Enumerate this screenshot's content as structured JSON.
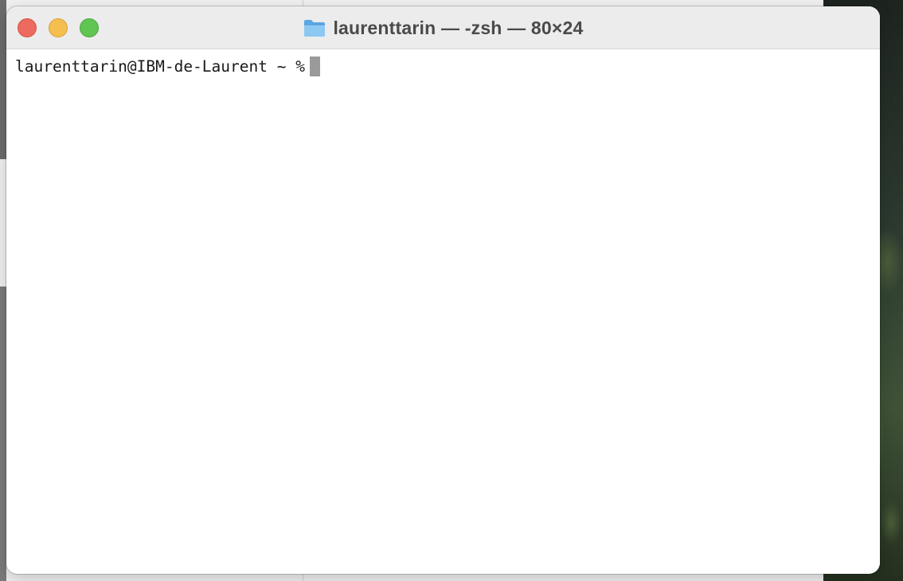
{
  "window": {
    "title": "laurenttarin — -zsh — 80×24",
    "title_icon": "folder-icon",
    "buttons": {
      "close_color": "#ed6a5e",
      "minimize_color": "#f5bf4f",
      "zoom_color": "#61c554"
    }
  },
  "terminal": {
    "prompt": "laurenttarin@IBM-de-Laurent ~ %",
    "input": ""
  }
}
